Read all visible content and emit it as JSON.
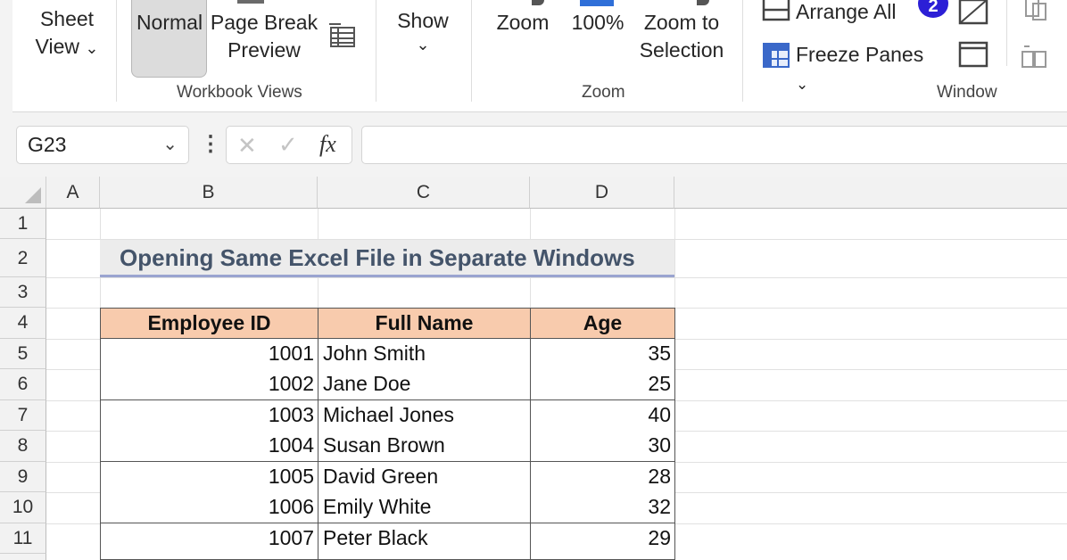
{
  "ribbon": {
    "sheet_view": {
      "line1": "Sheet",
      "line2": "View",
      "caret": "⌄"
    },
    "normal": "Normal",
    "page_break": {
      "line1": "Page Break",
      "line2": "Preview"
    },
    "group_workbook_views": "Workbook Views",
    "show": {
      "label": "Show",
      "caret": "⌄"
    },
    "zoom": "Zoom",
    "zoom100": "100%",
    "zoom_to_selection": {
      "line1": "Zoom to",
      "line2": "Selection"
    },
    "group_zoom": "Zoom",
    "arrange_all": "Arrange All",
    "freeze_panes": {
      "label": "Freeze Panes",
      "caret": "⌄"
    },
    "badge": "2",
    "group_window": "Window"
  },
  "formula_bar": {
    "name_box": "G23",
    "name_caret": "⌄",
    "more": "⋮",
    "cancel": "✕",
    "enter": "✓",
    "fx": "fx",
    "content": ""
  },
  "sheet": {
    "columns": [
      "A",
      "B",
      "C",
      "D"
    ],
    "rows": [
      "1",
      "2",
      "3",
      "4",
      "5",
      "6",
      "7",
      "8",
      "9",
      "10",
      "11"
    ],
    "title": "Opening Same Excel File in Separate Windows",
    "headers": [
      "Employee ID",
      "Full Name",
      "Age"
    ],
    "data": [
      [
        "1001",
        "John Smith",
        "35"
      ],
      [
        "1002",
        "Jane Doe",
        "25"
      ],
      [
        "1003",
        "Michael Jones",
        "40"
      ],
      [
        "1004",
        "Susan Brown",
        "30"
      ],
      [
        "1005",
        "David Green",
        "28"
      ],
      [
        "1006",
        "Emily White",
        "32"
      ],
      [
        "1007",
        "Peter Black",
        "29"
      ]
    ]
  },
  "colors": {
    "header_fill": "#f8cbad",
    "title_text": "#44546a",
    "badge": "#2c1fd6"
  }
}
